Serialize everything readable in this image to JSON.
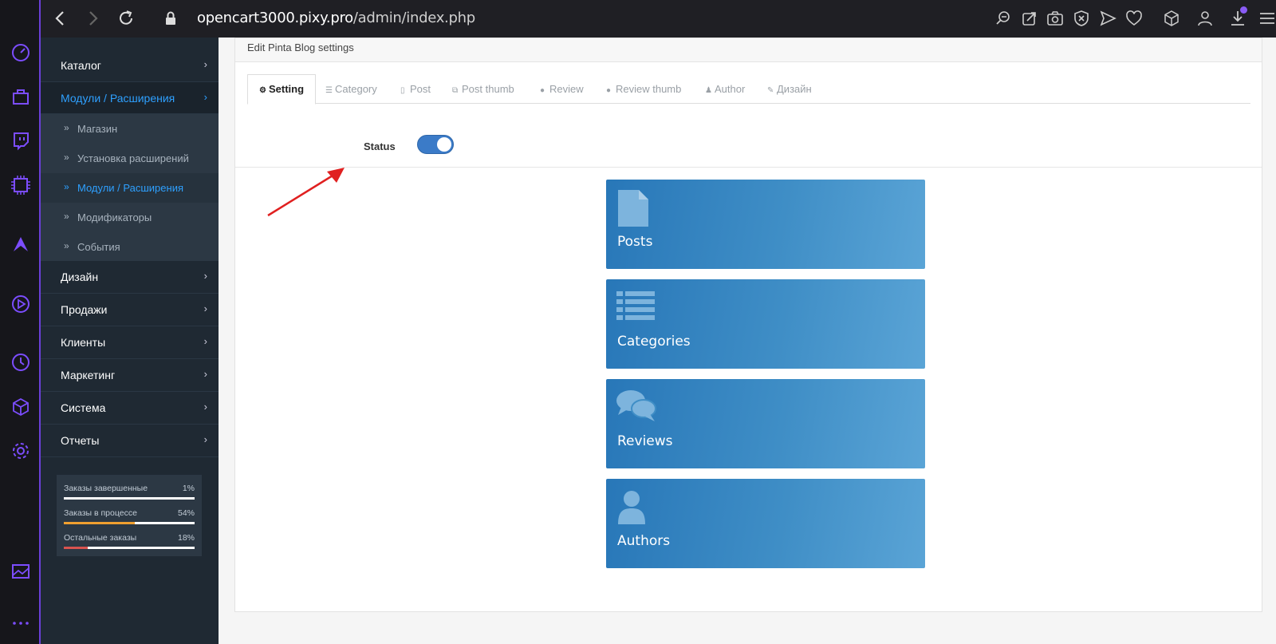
{
  "browser": {
    "url_host": "opencart3000.pixy.pro",
    "url_path": "/admin/index.php"
  },
  "sidebar": {
    "menu": [
      {
        "label": "Каталог"
      },
      {
        "label": "Модули / Расширения"
      },
      {
        "label": "Дизайн"
      },
      {
        "label": "Продажи"
      },
      {
        "label": "Клиенты"
      },
      {
        "label": "Маркетинг"
      },
      {
        "label": "Система"
      },
      {
        "label": "Отчеты"
      }
    ],
    "submenu": [
      {
        "label": "Магазин"
      },
      {
        "label": "Установка расширений"
      },
      {
        "label": "Модули / Расширения"
      },
      {
        "label": "Модификаторы"
      },
      {
        "label": "События"
      }
    ],
    "stats": [
      {
        "label": "Заказы завершенные",
        "percent": "1%",
        "value": 0.01,
        "color": "#ffffff"
      },
      {
        "label": "Заказы в процессе",
        "percent": "54%",
        "value": 0.54,
        "color": "#f0a030"
      },
      {
        "label": "Остальные заказы",
        "percent": "18%",
        "value": 0.18,
        "color": "#d9534f"
      }
    ]
  },
  "page": {
    "title": "Edit Pinta Blog settings",
    "tabs": [
      {
        "label": "Setting",
        "icon": "gear-icon"
      },
      {
        "label": "Category",
        "icon": "list-icon"
      },
      {
        "label": "Post",
        "icon": "file-icon"
      },
      {
        "label": "Post thumb",
        "icon": "files-icon"
      },
      {
        "label": "Review",
        "icon": "comment-icon"
      },
      {
        "label": "Review thumb",
        "icon": "comments-icon"
      },
      {
        "label": "Author",
        "icon": "user-icon"
      },
      {
        "label": "Дизайн",
        "icon": "brush-icon"
      }
    ],
    "status_label": "Status",
    "status_enabled": true,
    "cards": [
      {
        "label": "Posts",
        "icon": "file-icon"
      },
      {
        "label": "Categories",
        "icon": "list-icon"
      },
      {
        "label": "Reviews",
        "icon": "comments-icon"
      },
      {
        "label": "Authors",
        "icon": "user-icon"
      }
    ]
  },
  "colors": {
    "accent": "#2ea0ff",
    "card": "#2877b8",
    "toggle": "#3b7bc8",
    "arrow": "#e02020",
    "browser_accent": "#6a3fd8"
  }
}
